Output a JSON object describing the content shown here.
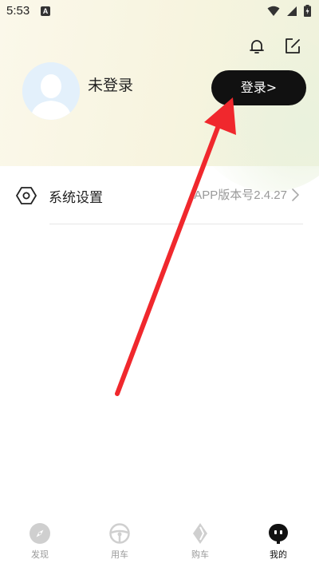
{
  "status_bar": {
    "time": "5:53",
    "notif_letter": "A"
  },
  "profile": {
    "name": "未登录",
    "login_button": "登录>"
  },
  "settings": {
    "label": "系统设置",
    "version": "APP版本号2.4.27"
  },
  "nav": [
    {
      "label": "发现",
      "icon": "compass-icon",
      "active": false
    },
    {
      "label": "用车",
      "icon": "steering-wheel-icon",
      "active": false
    },
    {
      "label": "购车",
      "icon": "diamond-icon",
      "active": false
    },
    {
      "label": "我的",
      "icon": "robot-face-icon",
      "active": true
    }
  ],
  "colors": {
    "accent": "#111111",
    "annotation": "#f0282d",
    "header_bg": "#f8f5e2",
    "inactive": "#999999"
  }
}
